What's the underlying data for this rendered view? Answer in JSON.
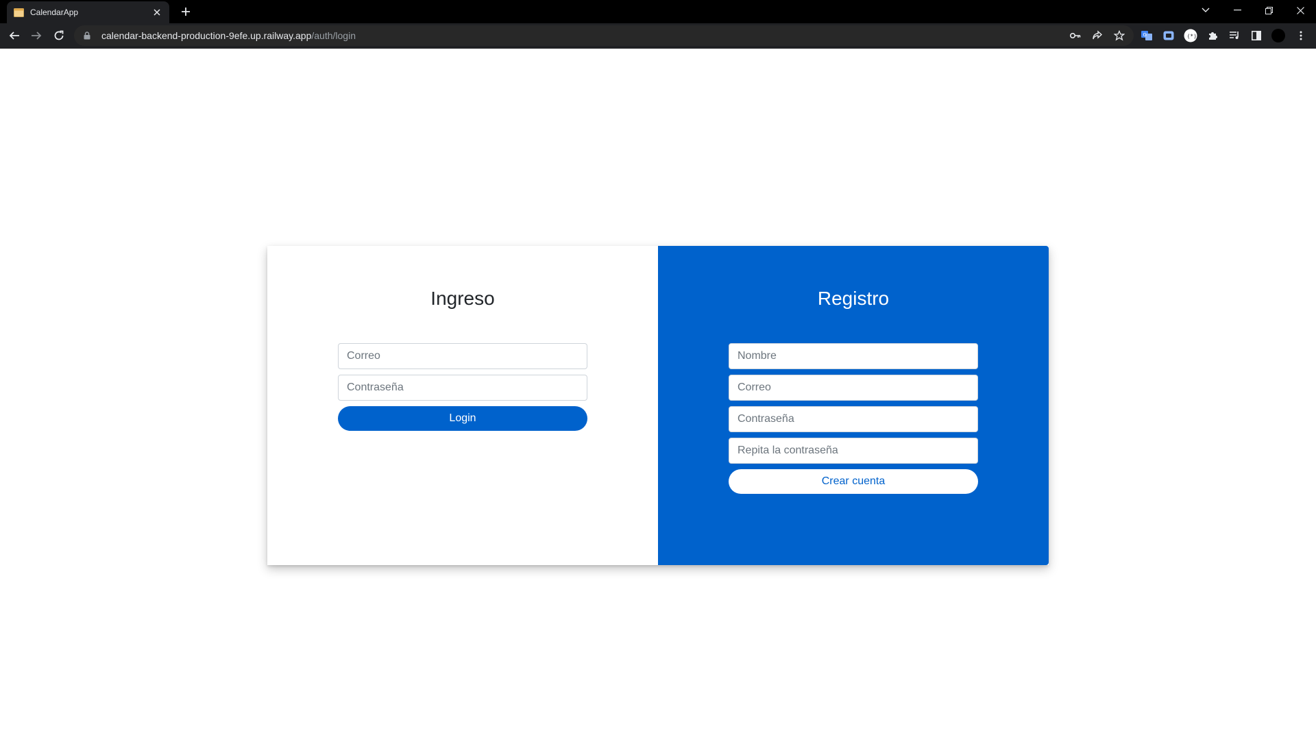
{
  "browser": {
    "tab_title": "CalendarApp",
    "url_host": "calendar-backend-production-9efe.up.railway.app",
    "url_path": "/auth/login"
  },
  "login": {
    "title": "Ingreso",
    "email_placeholder": "Correo",
    "password_placeholder": "Contraseña",
    "submit_label": "Login"
  },
  "register": {
    "title": "Registro",
    "name_placeholder": "Nombre",
    "email_placeholder": "Correo",
    "password_placeholder": "Contraseña",
    "password_repeat_placeholder": "Repita la contraseña",
    "submit_label": "Crear cuenta"
  },
  "colors": {
    "primary": "#0062cc",
    "chrome_dark": "#202124"
  }
}
